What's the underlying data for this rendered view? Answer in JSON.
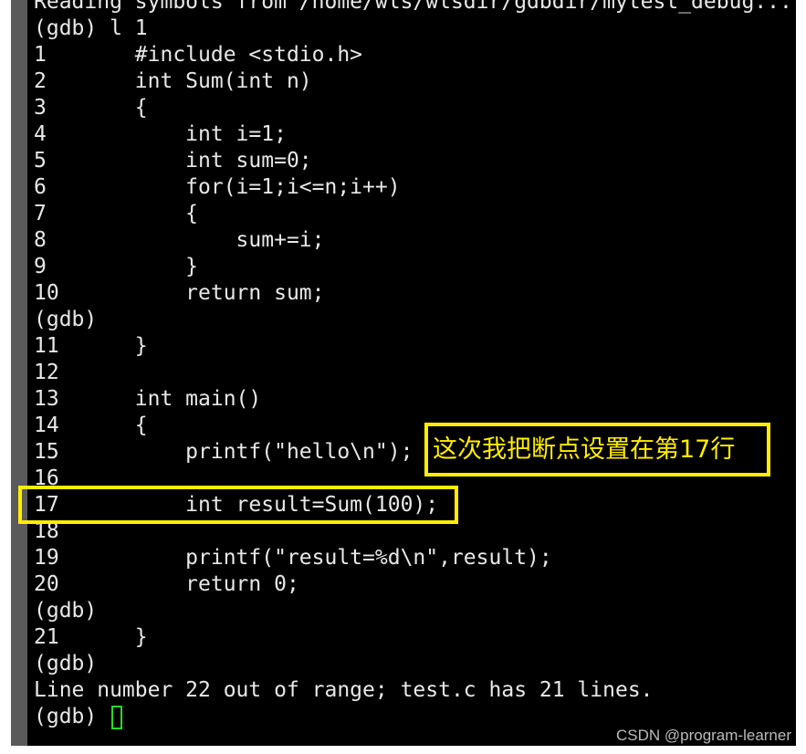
{
  "terminal": {
    "lines": [
      "Reading symbols from /home/wls/wlsdir/gdbdir/mytest_debug...",
      "(gdb) l 1",
      "1       #include <stdio.h>",
      "2       int Sum(int n)",
      "3       {",
      "4           int i=1;",
      "5           int sum=0;",
      "6           for(i=1;i<=n;i++)",
      "7           {",
      "8               sum+=i;",
      "9           }",
      "10          return sum;",
      "(gdb)",
      "11      }",
      "12",
      "13      int main()",
      "14      {",
      "15          printf(\"hello\\n\");",
      "16",
      "17          int result=Sum(100);",
      "18",
      "19          printf(\"result=%d\\n\",result);",
      "20          return 0;",
      "(gdb)",
      "21      }",
      "(gdb)",
      "Line number 22 out of range; test.c has 21 lines."
    ],
    "prompt": "(gdb) "
  },
  "annotation": {
    "note": "这次我把断点设置在第17行",
    "color": "#ffee00"
  },
  "watermark": "CSDN @program-learner"
}
